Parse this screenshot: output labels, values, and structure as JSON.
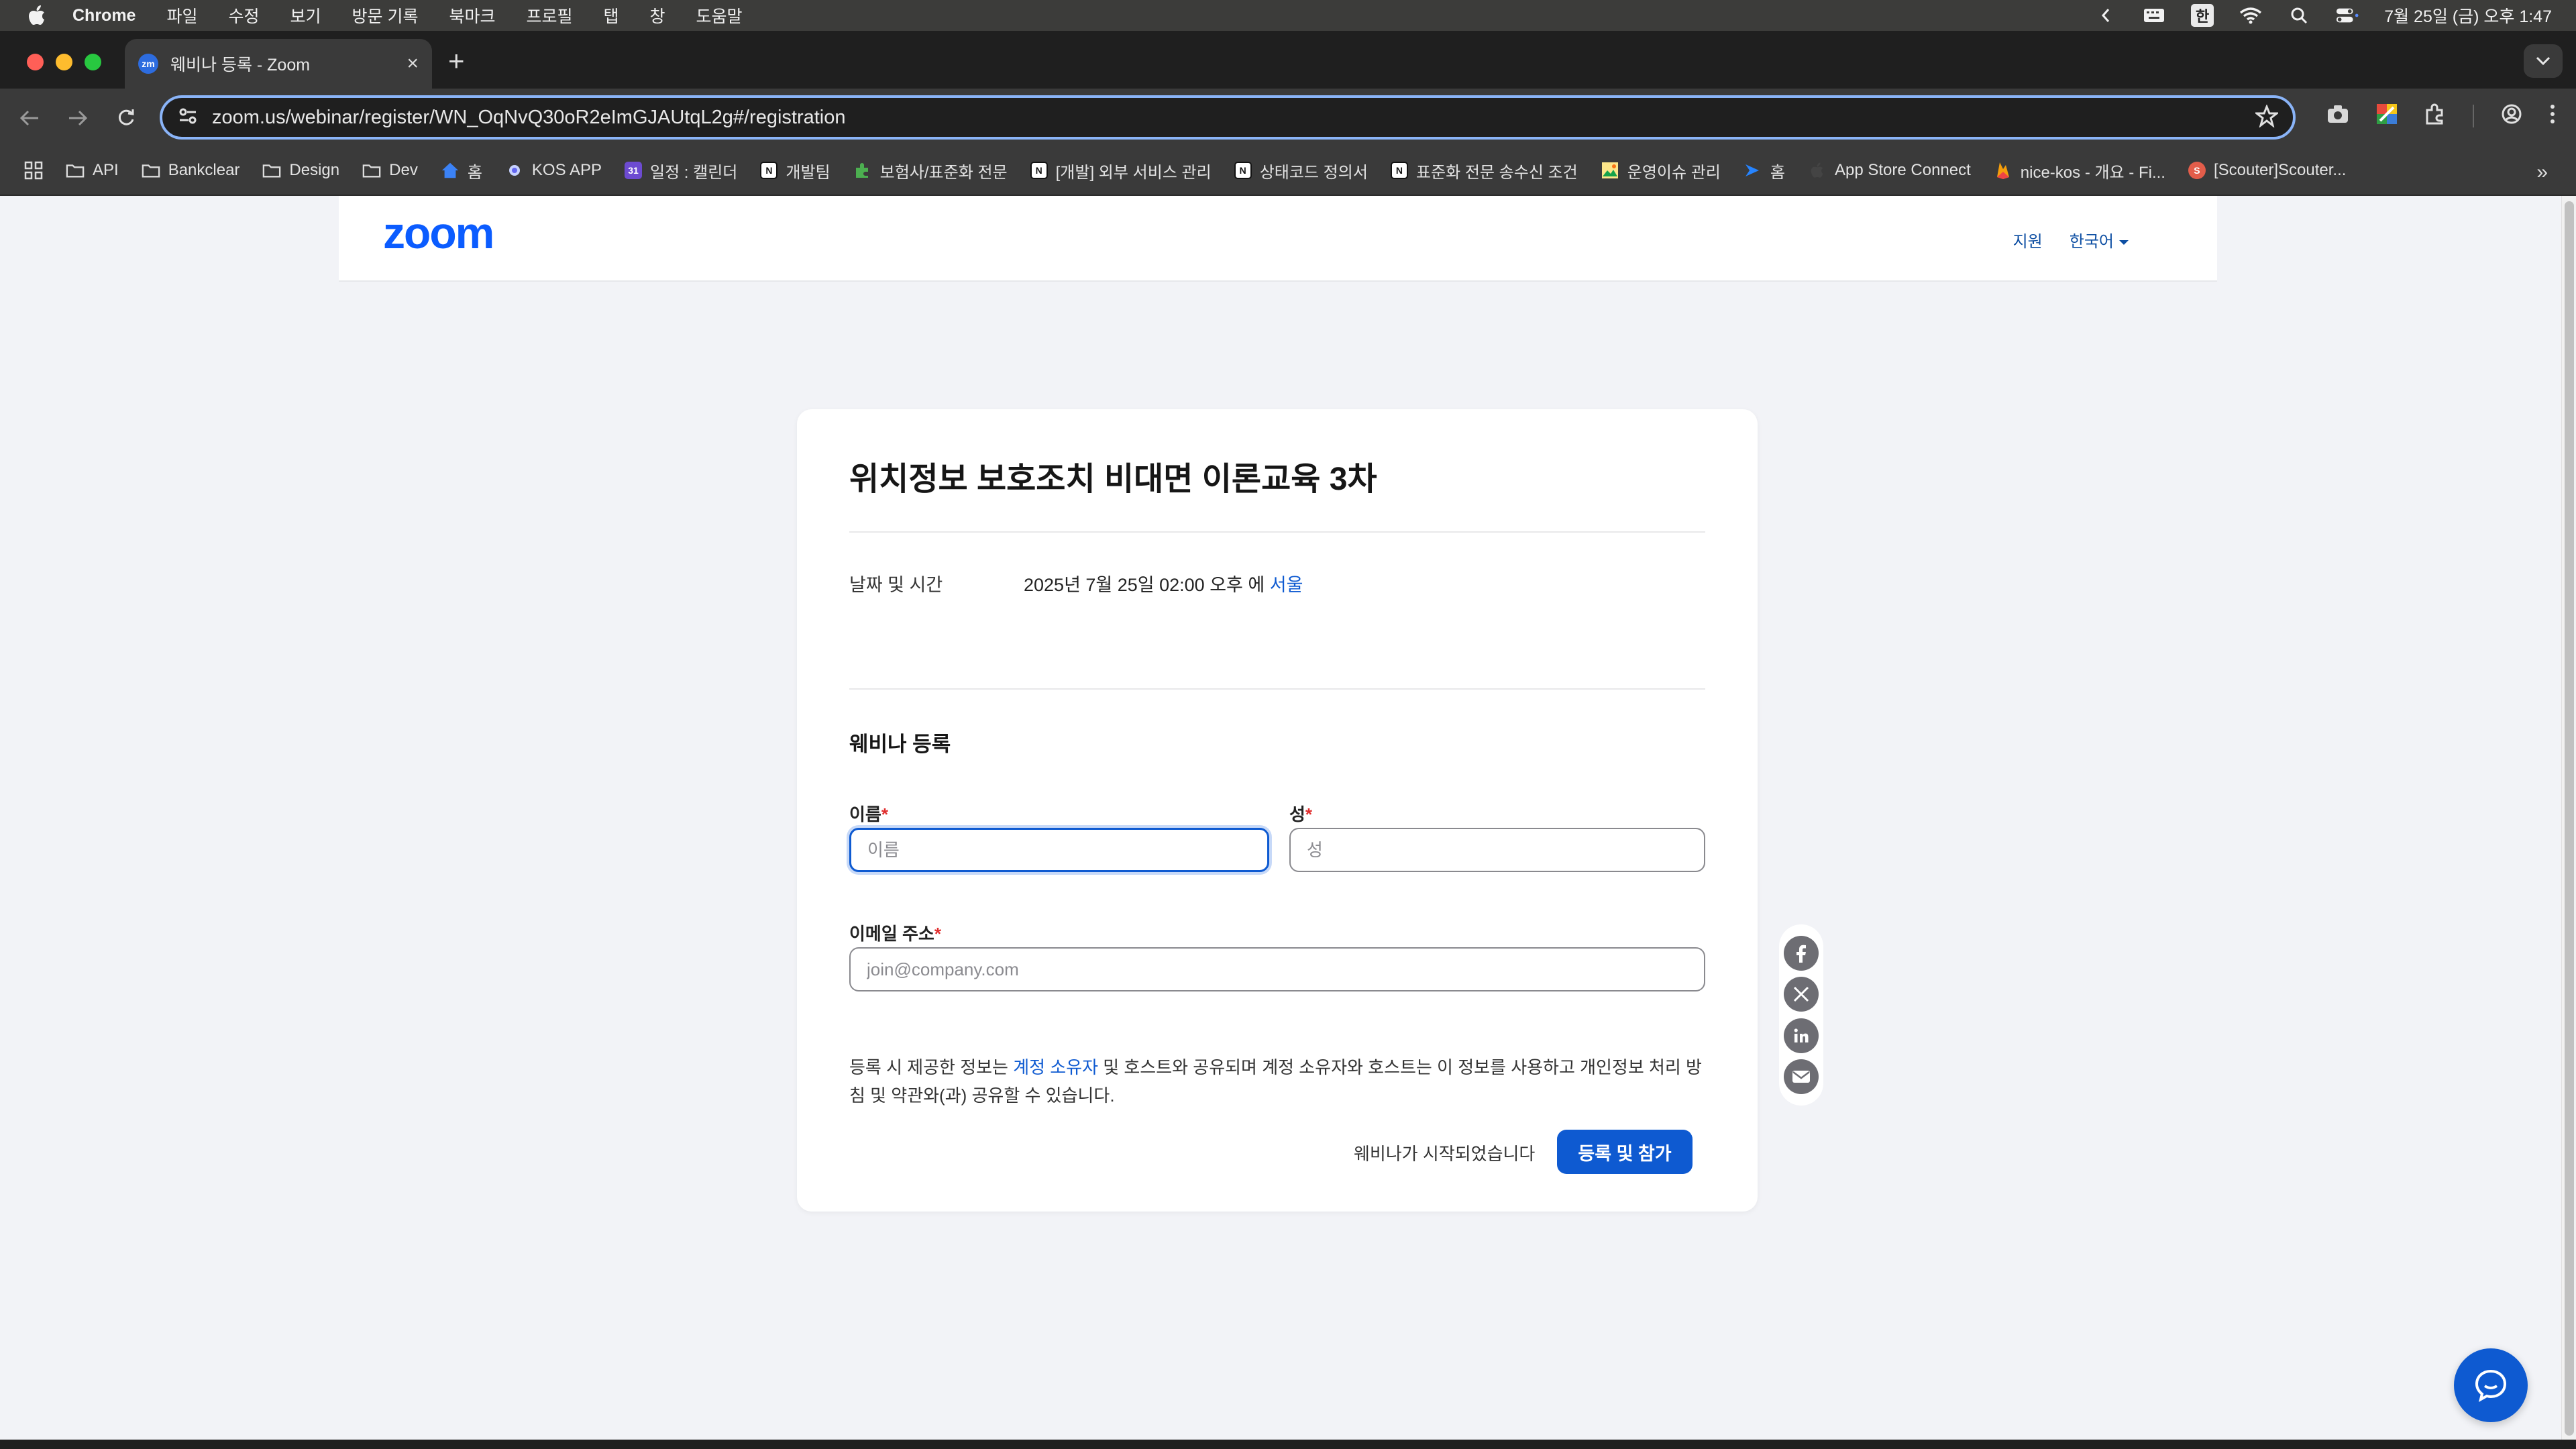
{
  "menubar": {
    "app_name": "Chrome",
    "items": [
      "파일",
      "수정",
      "보기",
      "방문 기록",
      "북마크",
      "프로필",
      "탭",
      "창",
      "도움말"
    ],
    "ime": "한",
    "clock": "7월 25일 (금) 오후 1:47"
  },
  "tab": {
    "favicon": "zm",
    "title": "웨비나 등록 - Zoom"
  },
  "toolbar": {
    "url": "zoom.us/webinar/register/WN_OqNvQ30oR2eImGJAUtqL2g#/registration"
  },
  "bookmarks": [
    {
      "label": "API",
      "icon": "folder-icon"
    },
    {
      "label": "Bankclear",
      "icon": "folder-icon"
    },
    {
      "label": "Design",
      "icon": "folder-icon"
    },
    {
      "label": "Dev",
      "icon": "folder-icon"
    },
    {
      "label": "홈",
      "icon": "home-icon"
    },
    {
      "label": "KOS APP",
      "icon": "app-icon"
    },
    {
      "label": "일정 : 캘린더",
      "icon": "calendar-icon"
    },
    {
      "label": "개발팀",
      "icon": "notion-icon"
    },
    {
      "label": "보험사/표준화 전문",
      "icon": "puzzle-icon"
    },
    {
      "label": "[개발] 외부 서비스 관리",
      "icon": "notion-icon"
    },
    {
      "label": "상태코드 정의서",
      "icon": "notion-icon"
    },
    {
      "label": "표준화 전문 송수신 조건",
      "icon": "notion-icon"
    },
    {
      "label": "운영이슈 관리",
      "icon": "image-icon"
    },
    {
      "label": "홈",
      "icon": "jira-icon"
    },
    {
      "label": "App Store Connect",
      "icon": "apple-icon"
    },
    {
      "label": "nice-kos - 개요 - Fi...",
      "icon": "firebase-icon"
    },
    {
      "label": "[Scouter]Scouter...",
      "icon": "scouter-icon"
    }
  ],
  "header": {
    "logo": "zoom",
    "support": "지원",
    "language": "한국어"
  },
  "webinar": {
    "title": "위치정보 보호조치 비대면 이론교육 3차",
    "datetime_label": "날짜 및 시간",
    "datetime_value": "2025년 7월 25일 02:00 오후 에 ",
    "timezone_link": "서울",
    "registration_title": "웨비나 등록"
  },
  "form": {
    "first_name_label": "이름",
    "first_name_placeholder": "이름",
    "last_name_label": "성",
    "last_name_placeholder": "성",
    "email_label": "이메일 주소",
    "email_placeholder": "join@company.com",
    "required_mark": "*"
  },
  "disclaimer": {
    "pre": "등록 시 제공한 정보는 ",
    "link": "계정 소유자",
    "post": " 및 호스트와 공유되며 계정 소유자와 호스트는 이 정보를 사용하고 개인정보 처리 방침 및 약관와(과) 공유할 수 있습니다."
  },
  "actions": {
    "started_text": "웨비나가 시작되었습니다",
    "submit_label": "등록 및 참가"
  },
  "share": [
    "facebook-icon",
    "x-icon",
    "linkedin-icon",
    "email-icon"
  ],
  "colors": {
    "accent": "#0e5ad1",
    "required": "#e02d2d",
    "page_bg": "#f2f3f7"
  }
}
